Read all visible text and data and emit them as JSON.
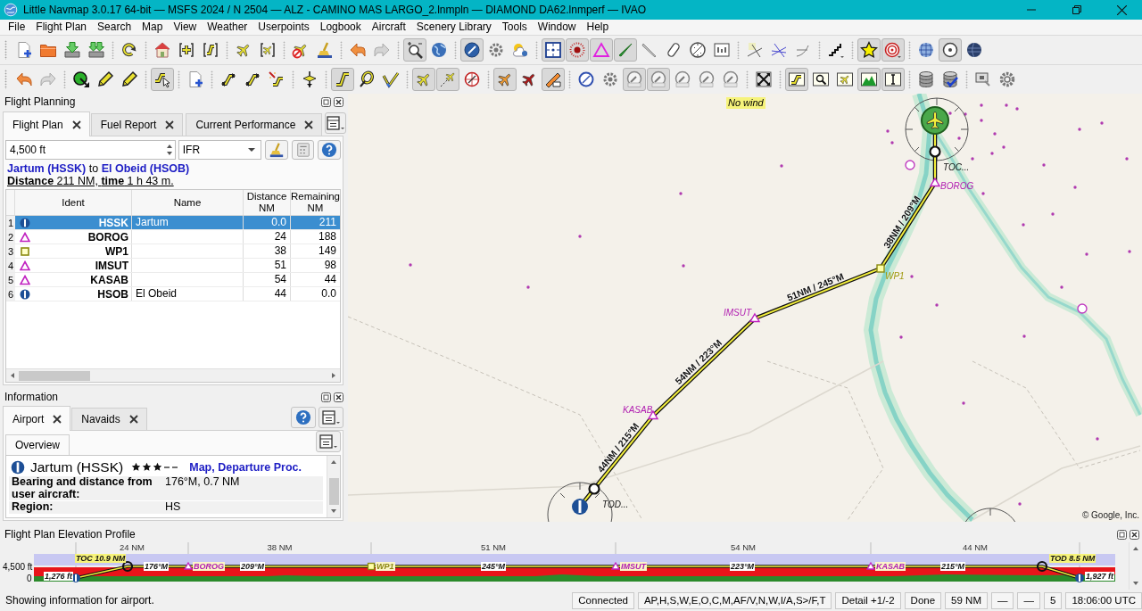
{
  "window": {
    "title": "Little Navmap 3.0.17 64-bit — MSFS 2024 / N 2504 — ALZ - CAMINO MAS LARGO_2.lnmpln — DIAMOND DA62.lnmperf — IVAO"
  },
  "menu": [
    "File",
    "Flight Plan",
    "Search",
    "Map",
    "View",
    "Weather",
    "Userpoints",
    "Logbook",
    "Aircraft",
    "Scenery Library",
    "Tools",
    "Window",
    "Help"
  ],
  "toolbars": [
    {
      "groups": [
        [
          {
            "pressed": false
          },
          {
            "pressed": false
          },
          {
            "pressed": false
          },
          {
            "pressed": false
          }
        ],
        [
          {
            "pressed": false
          }
        ],
        [
          {
            "pressed": false
          },
          {
            "pressed": false
          },
          {
            "pressed": false
          }
        ],
        [
          {
            "pressed": false
          },
          {
            "pressed": false
          }
        ],
        [
          {
            "pressed": false
          },
          {
            "pressed": false
          }
        ],
        [
          {
            "pressed": false
          },
          {
            "pressed": false
          }
        ],
        [
          {
            "pressed": true
          },
          {
            "pressed": false
          }
        ],
        [
          {
            "pressed": true
          },
          {
            "pressed": false
          },
          {
            "pressed": false
          }
        ],
        [
          {
            "pressed": true
          },
          {
            "pressed": true
          },
          {
            "pressed": true
          },
          {
            "pressed": true
          },
          {
            "pressed": false
          },
          {
            "pressed": false
          },
          {
            "pressed": false
          },
          {
            "pressed": false
          }
        ],
        [
          {
            "pressed": false
          },
          {
            "pressed": false
          },
          {
            "pressed": false
          }
        ],
        [
          {
            "pressed": false
          }
        ],
        [
          {
            "pressed": true
          },
          {
            "pressed": true
          }
        ],
        [
          {
            "pressed": false
          },
          {
            "pressed": true
          },
          {
            "pressed": false
          }
        ]
      ]
    },
    {
      "groups": [
        [
          {
            "pressed": false
          },
          {
            "pressed": false
          }
        ],
        [
          {
            "pressed": false
          },
          {
            "pressed": false
          },
          {
            "pressed": false
          }
        ],
        [
          {
            "pressed": true
          }
        ],
        [
          {
            "pressed": false
          }
        ],
        [
          {
            "pressed": false
          },
          {
            "pressed": false
          },
          {
            "pressed": false
          }
        ],
        [
          {
            "pressed": false
          }
        ],
        [
          {
            "pressed": true
          },
          {
            "pressed": false
          },
          {
            "pressed": false
          }
        ],
        [
          {
            "pressed": true
          },
          {
            "pressed": true
          },
          {
            "pressed": false
          }
        ],
        [
          {
            "pressed": true
          },
          {
            "pressed": false
          },
          {
            "pressed": true
          }
        ],
        [
          {
            "pressed": false
          },
          {
            "pressed": false
          },
          {
            "pressed": true
          },
          {
            "pressed": true
          },
          {
            "pressed": false
          },
          {
            "pressed": false
          },
          {
            "pressed": false
          }
        ],
        [
          {
            "pressed": false
          }
        ],
        [
          {
            "pressed": true
          },
          {
            "pressed": false
          },
          {
            "pressed": false
          },
          {
            "pressed": true
          },
          {
            "pressed": true
          }
        ],
        [
          {
            "pressed": false
          },
          {
            "pressed": false
          }
        ],
        [
          {
            "pressed": false
          },
          {
            "pressed": false
          }
        ]
      ]
    }
  ],
  "flight_planning": {
    "title": "Flight Planning",
    "tabs": [
      {
        "label": "Flight Plan",
        "selected": true
      },
      {
        "label": "Fuel Report",
        "selected": false
      },
      {
        "label": "Current Performance",
        "selected": false
      }
    ],
    "altitude": "4,500 ft",
    "flight_rules": "IFR",
    "route": {
      "from": "Jartum (HSSK)",
      "joiner": "to",
      "to": "El Obeid (HSOB)"
    },
    "summary": "**Distance** 211 NM, **time** 1 h 43 m.",
    "table": {
      "columns": [
        "Ident",
        "Name",
        "Distance NM",
        "Remaining NM"
      ],
      "rows": [
        {
          "number": "1",
          "kind": "airport",
          "ident": "HSSK",
          "name": "Jartum",
          "distance": "0.0",
          "remaining": "211",
          "selected": true
        },
        {
          "number": "2",
          "kind": "waypoint",
          "ident": "BOROG",
          "distance": "24",
          "remaining": "188",
          "selected": false
        },
        {
          "number": "3",
          "kind": "userpoint",
          "ident": "WP1",
          "distance": "38",
          "remaining": "149",
          "selected": false
        },
        {
          "number": "4",
          "kind": "waypoint",
          "ident": "IMSUT",
          "distance": "51",
          "remaining": "98",
          "selected": false
        },
        {
          "number": "5",
          "kind": "waypoint",
          "ident": "KASAB",
          "distance": "54",
          "remaining": "44",
          "selected": false
        },
        {
          "number": "6",
          "kind": "airport",
          "ident": "HSOB",
          "name": "El Obeid",
          "distance": "44",
          "remaining": "0.0",
          "selected": false
        }
      ]
    }
  },
  "information": {
    "title": "Information",
    "tabs": [
      {
        "label": "Airport",
        "selected": true
      },
      {
        "label": "Navaids",
        "selected": false
      }
    ],
    "subtabs": [
      {
        "label": "Overview",
        "selected": true
      }
    ],
    "airport": {
      "name": "Jartum (HSSK)",
      "stars": 3,
      "links": "Map, Departure Proc.",
      "rows": [
        {
          "label": "Bearing and distance from user aircraft:",
          "value": "176°M, 0.7 NM"
        },
        {
          "label": "Region:",
          "value": "HS"
        }
      ]
    }
  },
  "map": {
    "wind": "No wind",
    "route_points": [
      {
        "label": "BOROG",
        "kind": "waypoint"
      },
      {
        "label": "WP1",
        "kind": "userpoint"
      },
      {
        "label": "IMSUT",
        "kind": "waypoint"
      },
      {
        "label": "KASAB",
        "kind": "waypoint"
      }
    ],
    "legs": [
      "38NM / 209°M",
      "51NM / 245°M",
      "54NM / 223°M",
      "44NM / 215°M"
    ],
    "toc": "TOC...",
    "tod": "TOD...",
    "attribution": "© Google, Inc."
  },
  "profile": {
    "title": "Flight Plan Elevation Profile",
    "altitude": "4,500 ft",
    "ground": "0",
    "legs": [
      {
        "distance": "24 NM",
        "course": "176°M"
      },
      {
        "distance": "38 NM",
        "course": "209°M"
      },
      {
        "distance": "51 NM",
        "course": "245°M"
      },
      {
        "distance": "54 NM",
        "course": "223°M"
      },
      {
        "distance": "44 NM",
        "course": "215°M"
      }
    ],
    "waypoints": [
      {
        "label": "BOROG",
        "kind": "waypoint"
      },
      {
        "label": "WP1",
        "kind": "userpoint"
      },
      {
        "label": "IMSUT",
        "kind": "waypoint"
      },
      {
        "label": "KASAB",
        "kind": "waypoint"
      }
    ],
    "toc": "TOC 10.9 NM",
    "tod": "TOD 8.5 NM",
    "departure_elevation": "1,276 ft",
    "destination_elevation": "1,927 ft"
  },
  "status_bar": {
    "message": "Showing information for airport.",
    "fields": [
      "Connected",
      "AP,H,S,W,E,O,C,M,AF/V,N,W,I/A,S>/F,T",
      "Detail +1/-2",
      "Done",
      "59 NM",
      "—",
      "—",
      "5",
      "18:06:00 UTC"
    ]
  }
}
